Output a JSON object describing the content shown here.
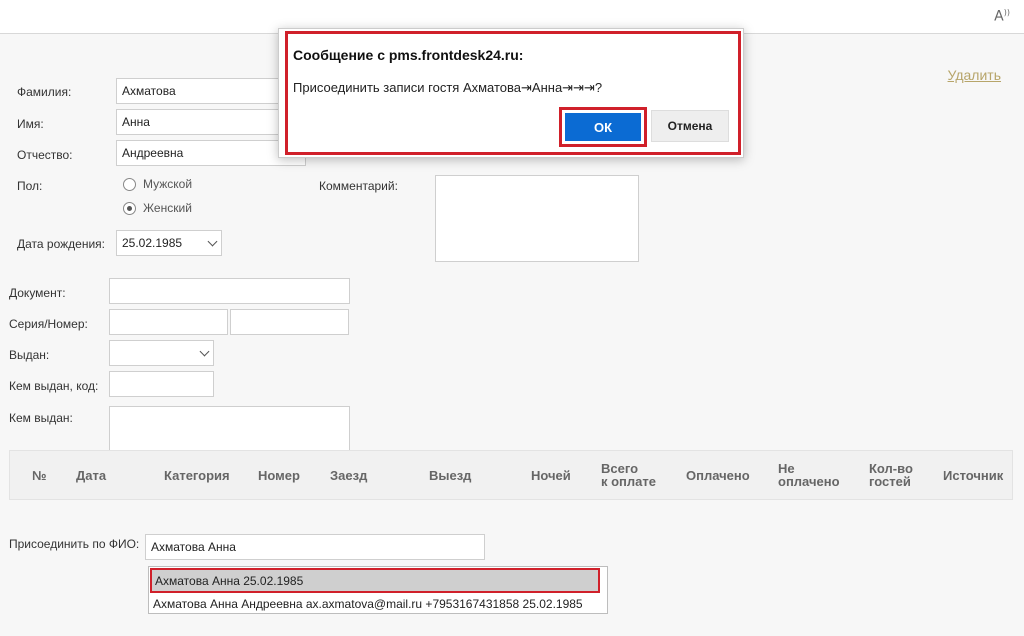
{
  "browser": {
    "read_aloud": "A"
  },
  "form": {
    "delete_link": "Удалить",
    "surname": {
      "label": "Фамилия:",
      "value": "Ахматова"
    },
    "name": {
      "label": "Имя:",
      "value": "Анна"
    },
    "patronymic": {
      "label": "Отчество:",
      "value": "Андреевна"
    },
    "gender": {
      "label": "Пол:",
      "options": [
        "Мужской",
        "Женский"
      ],
      "selected": "Женский"
    },
    "birthdate": {
      "label": "Дата рождения:",
      "value": "25.02.1985"
    },
    "comment": {
      "label": "Комментарий:",
      "value": ""
    },
    "document": {
      "label": "Документ:",
      "value": ""
    },
    "series_number": {
      "label": "Серия/Номер:",
      "series": "",
      "number": ""
    },
    "issued": {
      "label": "Выдан:",
      "value": ""
    },
    "issued_by_code": {
      "label": "Кем выдан, код:",
      "value": ""
    },
    "issued_by": {
      "label": "Кем выдан:",
      "value": ""
    }
  },
  "table": {
    "columns": [
      "№",
      "Дата",
      "Категория",
      "Номер",
      "Заезд",
      "Выезд",
      "Ночей",
      "Всего\nк оплате",
      "Оплачено",
      "Не\nоплачено",
      "Кол-во\nгостей",
      "Источник"
    ]
  },
  "join": {
    "label": "Присоединить по ФИО:",
    "value": "Ахматова Анна",
    "suggestions": [
      "Ахматова Анна 25.02.1985",
      "Ахматова Анна Андреевна ax.axmatova@mail.ru +7953167431858 25.02.1985"
    ]
  },
  "dialog": {
    "title": "Сообщение с pms.frontdesk24.ru:",
    "message": "Присоединить записи гостя Ахматова⇥Анна⇥⇥⇥?",
    "ok": "ОК",
    "cancel": "Отмена"
  },
  "colors": {
    "accent": "#0b6bd3",
    "highlight": "#d0202a",
    "link": "#b7a56a"
  }
}
